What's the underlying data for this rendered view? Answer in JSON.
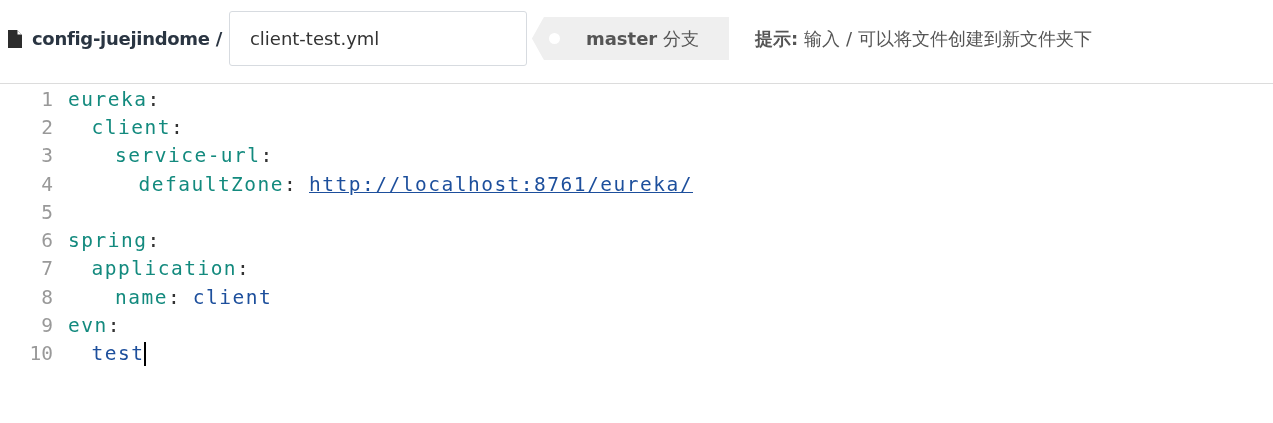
{
  "header": {
    "repo": "config-juejindome /",
    "filename": {
      "value": "client-test.yml"
    },
    "branch": {
      "name": "master",
      "suffix": "分支"
    },
    "hint": {
      "label": "提示:",
      "text": "输入 / 可以将文件创建到新文件夹下"
    }
  },
  "editor": {
    "lines": [
      {
        "number": "1",
        "tokens": [
          {
            "kind": "key",
            "text": "eureka"
          },
          {
            "kind": "punct",
            "text": ":"
          }
        ],
        "children": [
          {
            "number": "2",
            "tokens": [
              {
                "kind": "key",
                "text": "client"
              },
              {
                "kind": "punct",
                "text": ":"
              }
            ],
            "children": [
              {
                "number": "3",
                "tokens": [
                  {
                    "kind": "key",
                    "text": "service-url"
                  },
                  {
                    "kind": "punct",
                    "text": ":"
                  }
                ],
                "children": [
                  {
                    "number": "4",
                    "tokens": [
                      {
                        "kind": "key",
                        "text": "defaultZone"
                      },
                      {
                        "kind": "punct",
                        "text": ":"
                      },
                      {
                        "kind": "link",
                        "text": "http://localhost:8761/eureka/"
                      }
                    ]
                  }
                ]
              }
            ]
          }
        ]
      },
      {
        "number": "5"
      },
      {
        "number": "6",
        "tokens": [
          {
            "kind": "key",
            "text": "spring"
          },
          {
            "kind": "punct",
            "text": ":"
          }
        ],
        "children": [
          {
            "number": "7",
            "tokens": [
              {
                "kind": "key",
                "text": "application"
              },
              {
                "kind": "punct",
                "text": ":"
              }
            ],
            "children": [
              {
                "number": "8",
                "tokens": [
                  {
                    "kind": "key",
                    "text": "name"
                  },
                  {
                    "kind": "punct",
                    "text": ":"
                  },
                  {
                    "kind": "value",
                    "text": "client"
                  }
                ]
              }
            ]
          }
        ]
      },
      {
        "number": "9",
        "tokens": [
          {
            "kind": "key",
            "text": "evn"
          },
          {
            "kind": "punct",
            "text": ":"
          }
        ],
        "children": [
          {
            "number": "10",
            "cursor": true,
            "tokens": [
              {
                "kind": "value",
                "text": "test"
              }
            ]
          }
        ]
      }
    ]
  }
}
